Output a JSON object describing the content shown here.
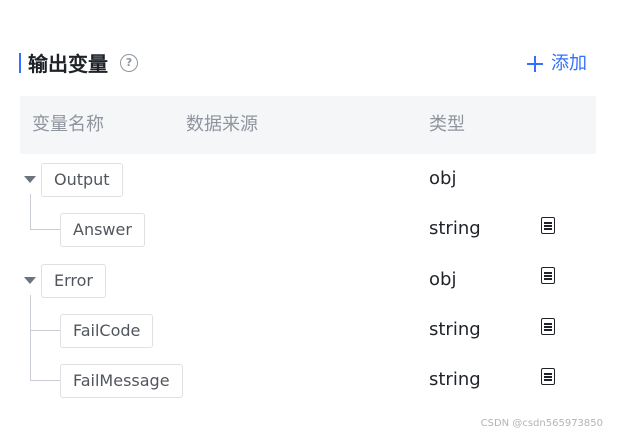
{
  "section": {
    "title": "输出变量",
    "help_icon": "?",
    "add_label": "添加"
  },
  "table": {
    "columns": [
      "变量名称",
      "数据来源",
      "类型"
    ],
    "rows": [
      {
        "name": "Output",
        "type": "obj",
        "expandable": true,
        "child": false,
        "doc_icon": false
      },
      {
        "name": "Answer",
        "type": "string",
        "expandable": false,
        "child": true,
        "doc_icon": true
      },
      {
        "name": "Error",
        "type": "obj",
        "expandable": true,
        "child": false,
        "doc_icon": true
      },
      {
        "name": "FailCode",
        "type": "string",
        "expandable": false,
        "child": true,
        "doc_icon": true
      },
      {
        "name": "FailMessage",
        "type": "string",
        "expandable": false,
        "child": true,
        "doc_icon": true
      }
    ]
  },
  "watermark": "CSDN @csdn565973850",
  "colors": {
    "accent": "#3370ff",
    "header_bg": "#f5f6f7",
    "muted": "#8f959e"
  }
}
